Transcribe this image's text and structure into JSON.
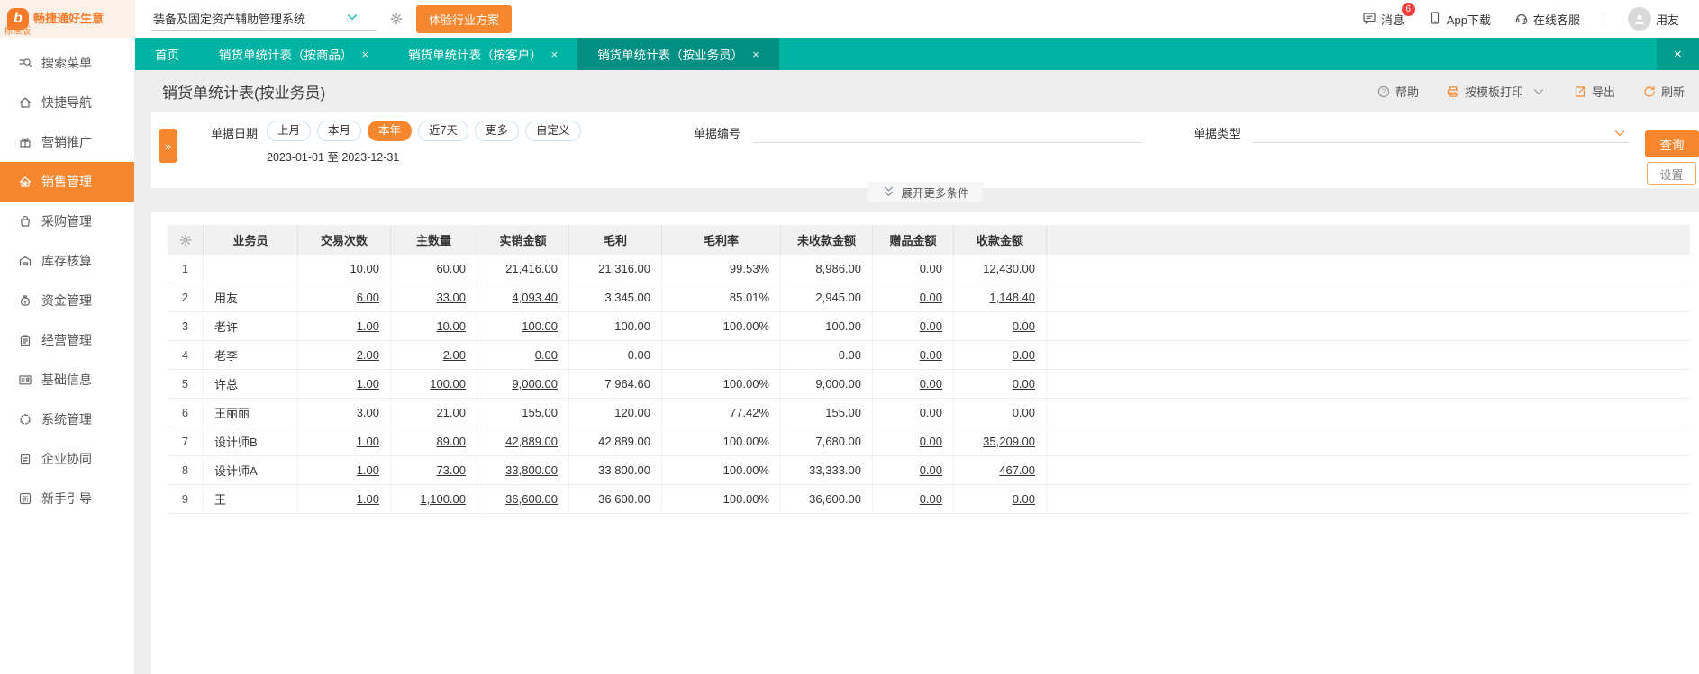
{
  "theme": {
    "accent_orange": "#f6872f",
    "teal_bar": "#00b3a2",
    "teal_active_tab": "#008f82",
    "badge_red": "#f03b3b",
    "logo_bg": "#fcf1e8"
  },
  "header": {
    "logo_text": "畅捷通好生意",
    "edition": "标准版",
    "system_select": "装备及固定资产辅助管理系统",
    "trial_button": "体验行业方案",
    "messages": "消息",
    "messages_badge": "6",
    "app_download": "App下载",
    "online_service": "在线客服",
    "user": "用友"
  },
  "sidebar": {
    "items": [
      {
        "label": "搜索菜单",
        "icon": "search",
        "active": false
      },
      {
        "label": "快捷导航",
        "icon": "home",
        "active": false
      },
      {
        "label": "营销推广",
        "icon": "gift",
        "active": false
      },
      {
        "label": "销售管理",
        "icon": "sale",
        "active": true
      },
      {
        "label": "采购管理",
        "icon": "bag",
        "active": false
      },
      {
        "label": "库存核算",
        "icon": "warehouse",
        "active": false
      },
      {
        "label": "资金管理",
        "icon": "money",
        "active": false
      },
      {
        "label": "经营管理",
        "icon": "clipboard",
        "active": false
      },
      {
        "label": "基础信息",
        "icon": "card",
        "active": false
      },
      {
        "label": "系统管理",
        "icon": "system",
        "active": false
      },
      {
        "label": "企业协同",
        "icon": "sync",
        "active": false
      },
      {
        "label": "新手引导",
        "icon": "guide",
        "active": false
      }
    ]
  },
  "tabs": [
    {
      "label": "首页",
      "closable": false,
      "active": false
    },
    {
      "label": "销货单统计表（按商品）",
      "closable": true,
      "active": false
    },
    {
      "label": "销货单统计表（按客户）",
      "closable": true,
      "active": false
    },
    {
      "label": "销货单统计表（按业务员）",
      "closable": true,
      "active": true
    }
  ],
  "page": {
    "title": "销货单统计表(按业务员)",
    "toolbar": {
      "help": "帮助",
      "print": "按模板打印",
      "export": "导出",
      "refresh": "刷新"
    }
  },
  "filters": {
    "date_label": "单据日期",
    "date_pills": [
      "上月",
      "本月",
      "本年",
      "近7天",
      "更多",
      "自定义"
    ],
    "active_pill": "本年",
    "date_range": "2023-01-01 至 2023-12-31",
    "doc_no_label": "单据编号",
    "doc_type_label": "单据类型",
    "query_button": "查询",
    "settings_button": "设置",
    "expand_more": "展开更多条件"
  },
  "table": {
    "columns": [
      "业务员",
      "交易次数",
      "主数量",
      "实销金额",
      "毛利",
      "毛利率",
      "未收款金额",
      "赠品金额",
      "收款金额"
    ],
    "value_links": [
      true,
      true,
      true,
      false,
      false,
      false,
      true,
      true
    ],
    "rows": [
      {
        "no": "1",
        "name": "",
        "values": [
          "10.00",
          "60.00",
          "21,416.00",
          "21,316.00",
          "99.53%",
          "8,986.00",
          "0.00",
          "12,430.00"
        ]
      },
      {
        "no": "2",
        "name": "用友",
        "values": [
          "6.00",
          "33.00",
          "4,093.40",
          "3,345.00",
          "85.01%",
          "2,945.00",
          "0.00",
          "1,148.40"
        ]
      },
      {
        "no": "3",
        "name": "老许",
        "values": [
          "1.00",
          "10.00",
          "100.00",
          "100.00",
          "100.00%",
          "100.00",
          "0.00",
          "0.00"
        ]
      },
      {
        "no": "4",
        "name": "老李",
        "values": [
          "2.00",
          "2.00",
          "0.00",
          "0.00",
          "",
          "0.00",
          "0.00",
          "0.00"
        ]
      },
      {
        "no": "5",
        "name": "许总",
        "values": [
          "1.00",
          "100.00",
          "9,000.00",
          "7,964.60",
          "100.00%",
          "9,000.00",
          "0.00",
          "0.00"
        ]
      },
      {
        "no": "6",
        "name": "王丽丽",
        "values": [
          "3.00",
          "21.00",
          "155.00",
          "120.00",
          "77.42%",
          "155.00",
          "0.00",
          "0.00"
        ]
      },
      {
        "no": "7",
        "name": "设计师B",
        "values": [
          "1.00",
          "89.00",
          "42,889.00",
          "42,889.00",
          "100.00%",
          "7,680.00",
          "0.00",
          "35,209.00"
        ]
      },
      {
        "no": "8",
        "name": "设计师A",
        "values": [
          "1.00",
          "73.00",
          "33,800.00",
          "33,800.00",
          "100.00%",
          "33,333.00",
          "0.00",
          "467.00"
        ]
      },
      {
        "no": "9",
        "name": "王",
        "values": [
          "1.00",
          "1,100.00",
          "36,600.00",
          "36,600.00",
          "100.00%",
          "36,600.00",
          "0.00",
          "0.00"
        ]
      }
    ]
  }
}
